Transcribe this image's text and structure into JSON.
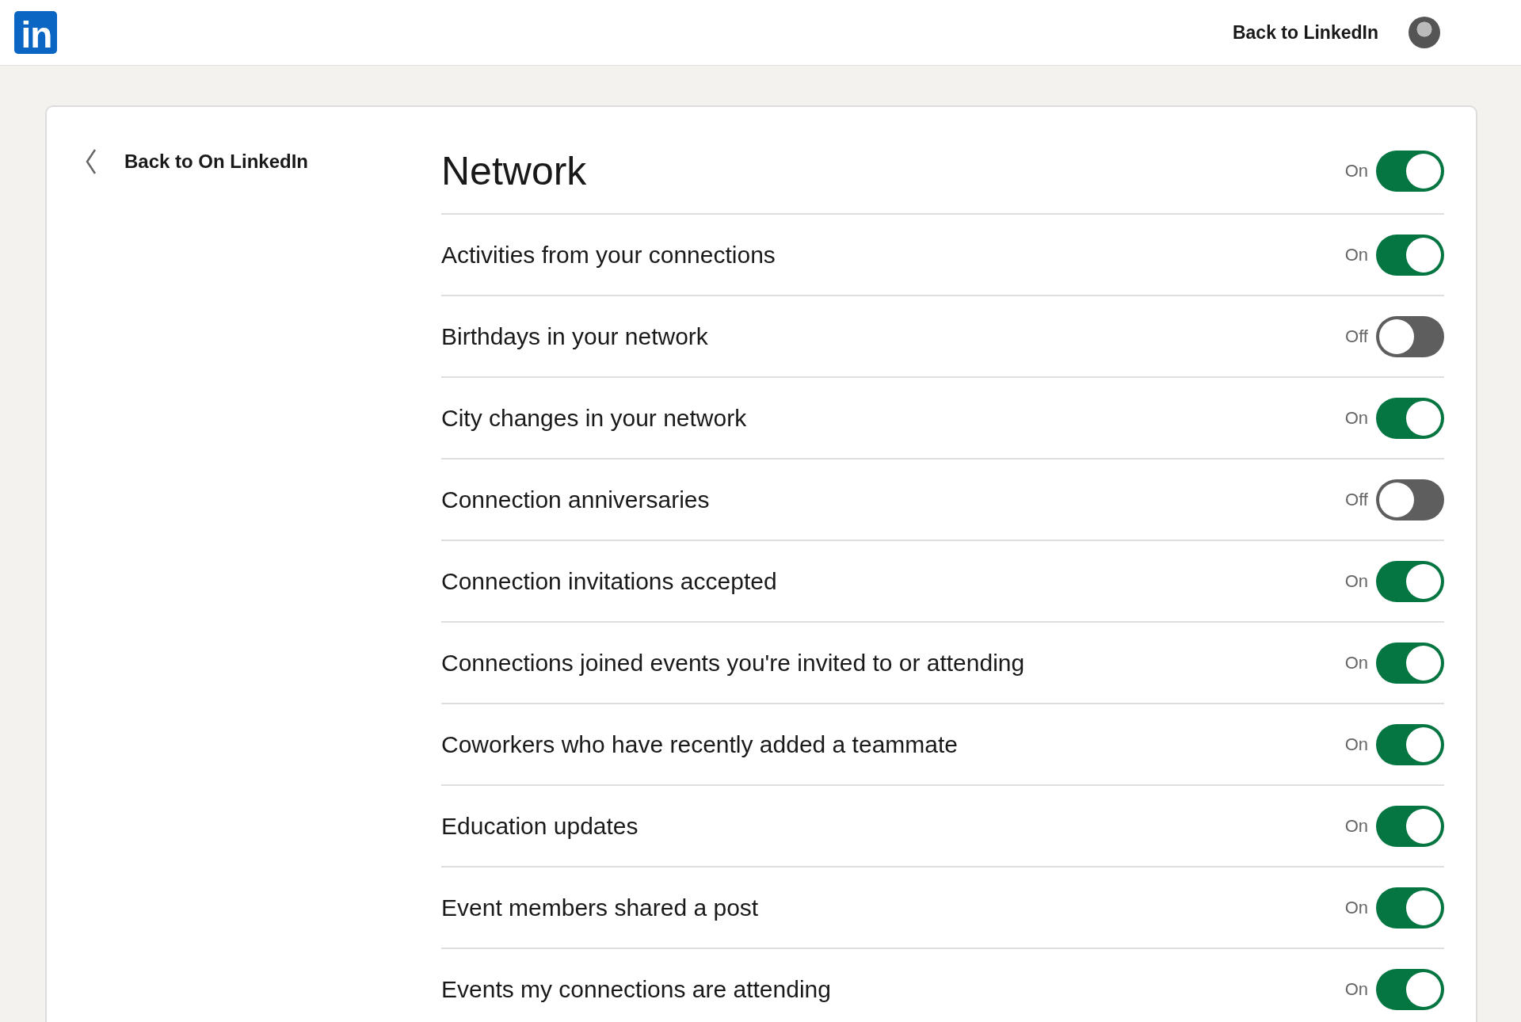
{
  "header": {
    "logo": "in",
    "back_link": "Back to LinkedIn"
  },
  "sidebar": {
    "back_link": "Back to On LinkedIn"
  },
  "section": {
    "title": "Network",
    "state_label": "On",
    "on": true
  },
  "settings": [
    {
      "label": "Activities from your connections",
      "state_label": "On",
      "on": true
    },
    {
      "label": "Birthdays in your network",
      "state_label": "Off",
      "on": false
    },
    {
      "label": "City changes in your network",
      "state_label": "On",
      "on": true
    },
    {
      "label": "Connection anniversaries",
      "state_label": "Off",
      "on": false
    },
    {
      "label": "Connection invitations accepted",
      "state_label": "On",
      "on": true
    },
    {
      "label": "Connections joined events you're invited to or attending",
      "state_label": "On",
      "on": true
    },
    {
      "label": "Coworkers who have recently added a teammate",
      "state_label": "On",
      "on": true
    },
    {
      "label": "Education updates",
      "state_label": "On",
      "on": true
    },
    {
      "label": "Event members shared a post",
      "state_label": "On",
      "on": true
    },
    {
      "label": "Events my connections are attending",
      "state_label": "On",
      "on": true
    }
  ]
}
